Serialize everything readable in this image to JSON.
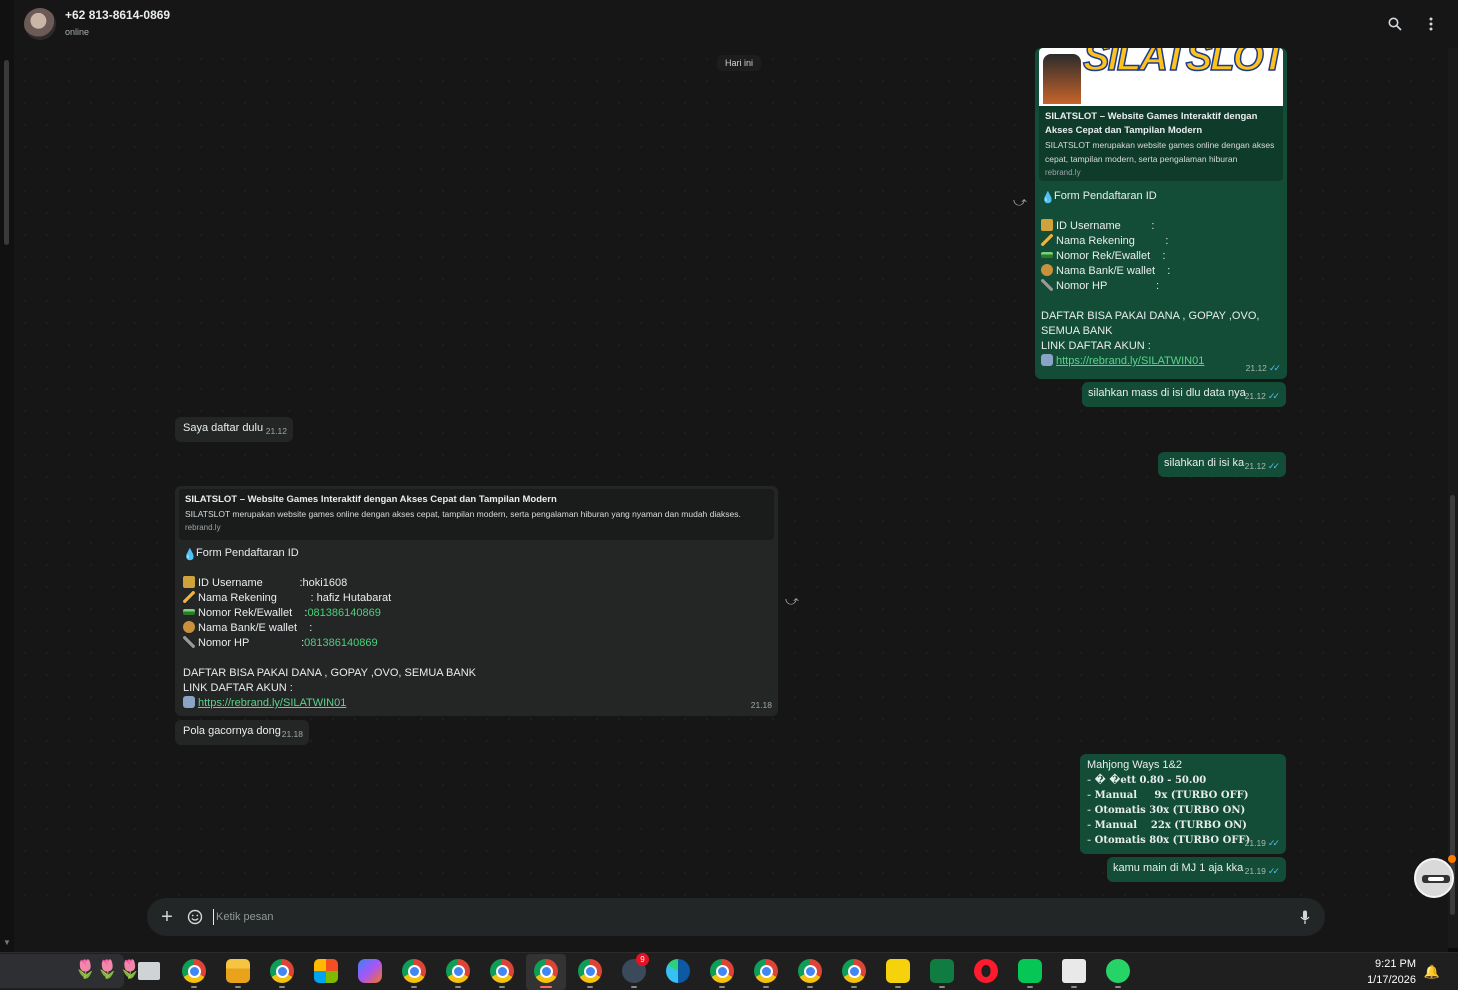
{
  "header": {
    "contact_name": "+62 813-8614-0869",
    "status": "online",
    "icons": [
      "search-icon",
      "menu-icon"
    ]
  },
  "chat": {
    "date_label": "Hari ini",
    "out_form": {
      "preview_brand": "SILATSLOT",
      "preview_title": "SILATSLOT – Website Games Interaktif dengan Akses Cepat dan Tampilan Modern",
      "preview_desc": "SILATSLOT merupakan website games online dengan akses cepat, tampilan modern, serta pengalaman hiburan",
      "preview_domain": "rebrand.ly",
      "form_title": "Form Pendaftaran ID",
      "field_username": "ID Username          :",
      "field_rekening": "Nama Rekening          :",
      "field_norek": "Nomor Rek/Ewallet    :",
      "field_bank": "Nama Bank/E wallet    :",
      "field_hp": "Nomor HP                :",
      "note": "DAFTAR BISA PAKAI DANA , GOPAY ,OVO, SEMUA BANK",
      "link_label": "LINK DAFTAR AKUN :",
      "link": "https://rebrand.ly/SILATWIN01",
      "time": "21.12"
    },
    "out_isi_mass": {
      "text": "silahkan mass di isi dlu data nya",
      "time": "21.12"
    },
    "in_daftar": {
      "text": "Saya daftar dulu",
      "time": "21.12"
    },
    "out_isi_ka": {
      "text": "silahkan di isi ka",
      "time": "21.12"
    },
    "in_form": {
      "preview_title": "SILATSLOT – Website Games Interaktif dengan Akses Cepat dan Tampilan Modern",
      "preview_desc": "SILATSLOT merupakan website games online dengan akses cepat, tampilan modern, serta pengalaman hiburan yang nyaman dan mudah diakses.",
      "preview_domain": "rebrand.ly",
      "form_title": "Form Pendaftaran ID",
      "lbl_username": "ID Username            ",
      "val_username": ":hoki1608",
      "lbl_rekening": "Nama Rekening           ",
      "val_rekening": ": hafiz Hutabarat",
      "lbl_norek": "Nomor Rek/Ewallet    ",
      "val_norek_colon": ":",
      "val_norek": "081386140869",
      "lbl_bank": "Nama Bank/E wallet    ",
      "val_bank": ":",
      "lbl_hp": "Nomor HP                 ",
      "val_hp_colon": ":",
      "val_hp": "081386140869",
      "note": "DAFTAR BISA PAKAI DANA , GOPAY ,OVO, SEMUA BANK",
      "link_label": "LINK DAFTAR AKUN :",
      "link": "https://rebrand.ly/SILATWIN01",
      "time": "21.18"
    },
    "in_pola": {
      "text": "Pola gacornya dong",
      "time": "21.18"
    },
    "out_mahjong": {
      "title": "Mahjong Ways 1&2",
      "l1": "� �ett 0.80 - 50.00",
      "l2": "Manual     9x (TURBO OFF)",
      "l3": "Otomatis 30x (TURBO ON)",
      "l4": "Manual    22x (TURBO ON)",
      "l5": "Otomatis 80x (TURBO OFF)",
      "time": "21.19"
    },
    "out_mj": {
      "text": "kamu main di MJ 1 aja kka",
      "time": "21.19"
    }
  },
  "composer": {
    "placeholder": "Ketik pesan"
  },
  "taskbar": {
    "time": "9:21 PM",
    "date": "1/17/2026",
    "badge_count": "9"
  },
  "colors": {
    "outgoing_bubble": "#134d37",
    "incoming_bubble": "#242626",
    "chat_bg": "#161616",
    "link_green": "#5bd48a"
  }
}
